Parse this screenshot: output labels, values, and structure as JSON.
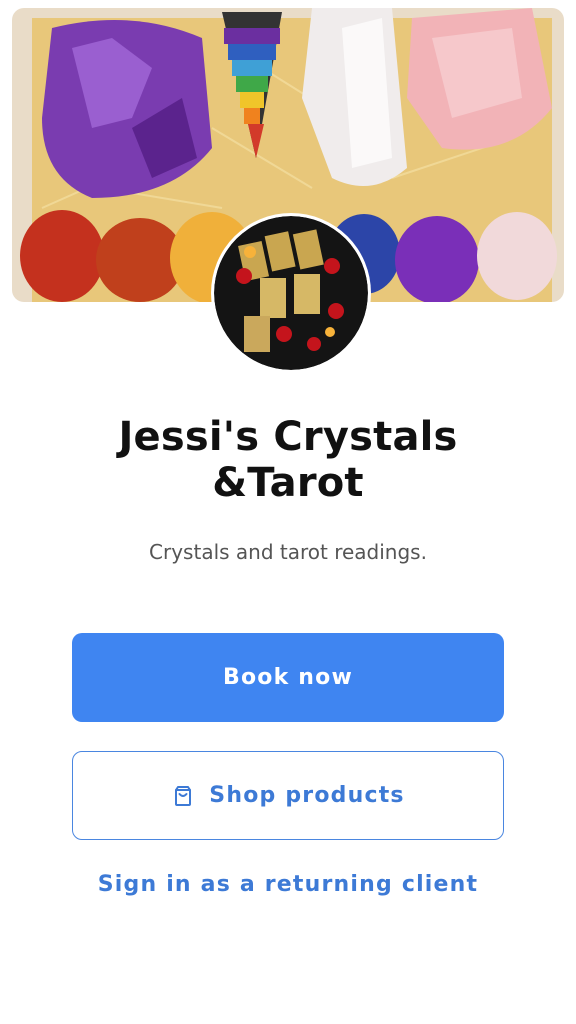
{
  "profile": {
    "name": "Jessi's Crystals &Tarot",
    "tagline": "Crystals and tarot readings."
  },
  "actions": {
    "book_label": "Book now",
    "shop_label": "Shop products",
    "signin_label": "Sign in as a returning client"
  },
  "icons": {
    "shop": "shopping-bag-icon"
  },
  "colors": {
    "primary": "#3f85f1",
    "link": "#3d7ad6",
    "title": "#111111",
    "subtitle": "#555555"
  }
}
